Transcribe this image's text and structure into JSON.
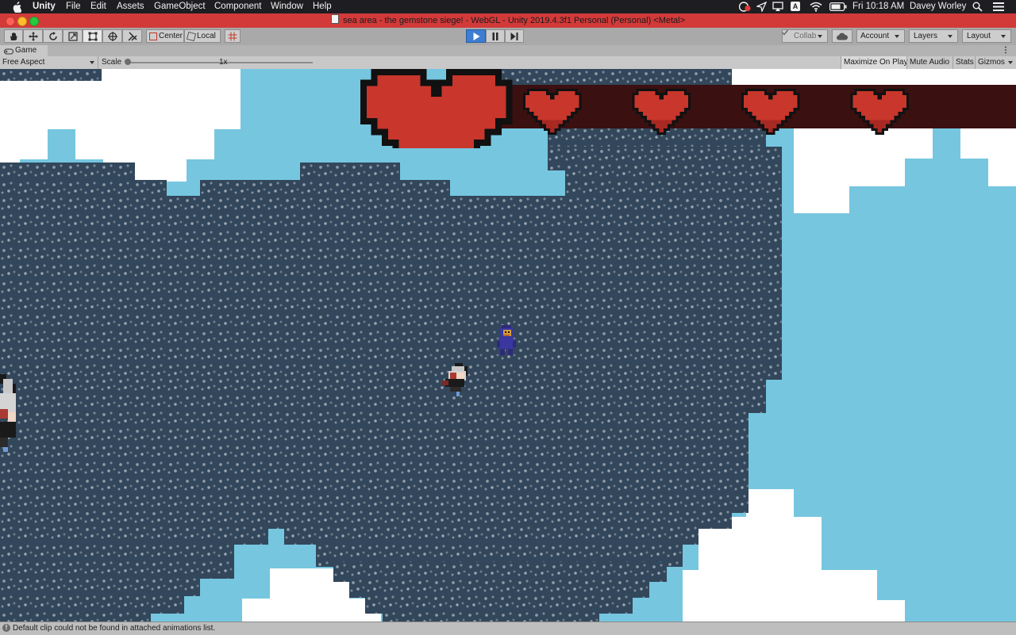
{
  "menubar": {
    "app_name": "Unity",
    "menus": [
      "File",
      "Edit",
      "Assets",
      "GameObject",
      "Component",
      "Window",
      "Help"
    ],
    "clock": "Fri 10:18 AM",
    "user": "Davey Worley",
    "input_source": "A"
  },
  "window": {
    "title": "sea area - the gemstone siege! - WebGL - Unity 2019.4.3f1 Personal (Personal) <Metal>"
  },
  "toolbar": {
    "tools": [
      "hand-tool",
      "move-tool",
      "rotate-tool",
      "scale-tool",
      "rect-tool",
      "transform-tool",
      "custom-tool"
    ],
    "pivot_mode": "Center",
    "pivot_rotation": "Local",
    "collab": "Collab",
    "account": "Account",
    "layers": "Layers",
    "layout": "Layout"
  },
  "game_view": {
    "tab_label": "Game",
    "aspect": "Free Aspect",
    "scale_label": "Scale",
    "scale_value": "1x",
    "maximize_on_play": "Maximize On Play",
    "mute_audio": "Mute Audio",
    "stats": "Stats",
    "gizmos": "Gizmos"
  },
  "hud": {
    "boss_hearts": 5,
    "colors": {
      "heart": "#c8362c",
      "heart_shade": "#a82822",
      "heart_bar": "#3a1010",
      "sky": "#76c6df",
      "rock": "#32475b",
      "cloud": "#ffffff"
    }
  },
  "status": {
    "message": "Default clip could not be found in attached animations list."
  },
  "colors": {
    "menubar": "#1e1e22",
    "titlebar": "#d23a3a",
    "toolbar": "#a9a9a9",
    "play_active": "#3d7dd2"
  }
}
